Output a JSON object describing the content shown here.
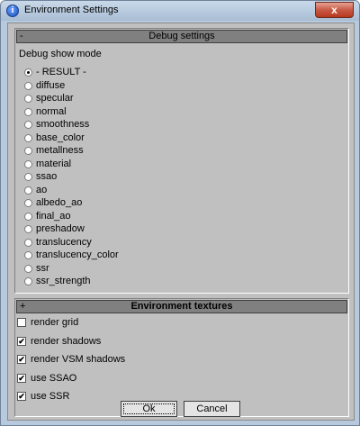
{
  "window": {
    "title": "Environment Settings",
    "icon": "info-icon",
    "close_label": "x"
  },
  "debug_group": {
    "sign": "-",
    "title": "Debug settings",
    "mode_label": "Debug show mode",
    "options": [
      {
        "label": "- RESULT -",
        "checked": true
      },
      {
        "label": "diffuse",
        "checked": false
      },
      {
        "label": "specular",
        "checked": false
      },
      {
        "label": "normal",
        "checked": false
      },
      {
        "label": "smoothness",
        "checked": false
      },
      {
        "label": "base_color",
        "checked": false
      },
      {
        "label": "metallness",
        "checked": false
      },
      {
        "label": "material",
        "checked": false
      },
      {
        "label": "ssao",
        "checked": false
      },
      {
        "label": "ao",
        "checked": false
      },
      {
        "label": "albedo_ao",
        "checked": false
      },
      {
        "label": "final_ao",
        "checked": false
      },
      {
        "label": "preshadow",
        "checked": false
      },
      {
        "label": "translucency",
        "checked": false
      },
      {
        "label": "translucency_color",
        "checked": false
      },
      {
        "label": "ssr",
        "checked": false
      },
      {
        "label": "ssr_strength",
        "checked": false
      }
    ]
  },
  "env_group": {
    "sign": "+",
    "title": "Environment textures",
    "checks": [
      {
        "label": "render grid",
        "checked": false
      },
      {
        "label": "render shadows",
        "checked": true
      },
      {
        "label": "render VSM shadows",
        "checked": true
      },
      {
        "label": "use SSAO",
        "checked": true
      },
      {
        "label": "use SSR",
        "checked": true
      }
    ]
  },
  "buttons": {
    "ok": "Ok",
    "cancel": "Cancel"
  }
}
